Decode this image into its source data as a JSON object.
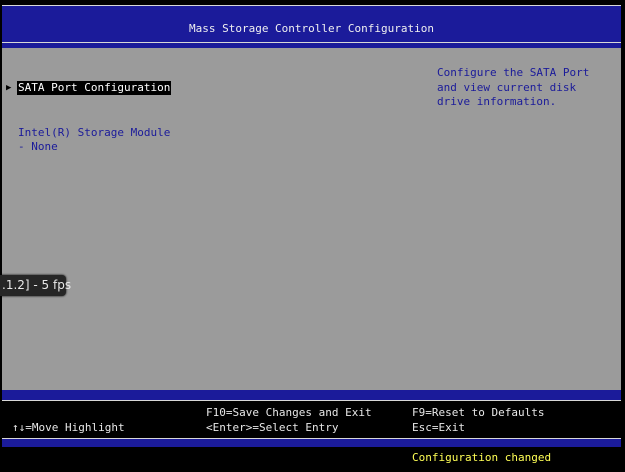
{
  "header": {
    "title": "Mass Storage Controller Configuration"
  },
  "main": {
    "selected_item": "SATA Port Configuration",
    "storage_module_label": "Intel(R) Storage Module",
    "storage_module_value": "- None",
    "help_text": "Configure the SATA Port and view current disk drive information."
  },
  "overlay": {
    "fps_text": ".1.2] - 5 fps"
  },
  "help_bar": {
    "move_highlight": "↑↓=Move Highlight",
    "save_exit": "F10=Save Changes and Exit",
    "select_entry": "<Enter>=Select Entry",
    "reset_defaults": "F9=Reset to Defaults",
    "esc_exit": "Esc=Exit"
  },
  "status": {
    "message": "Configuration changed"
  },
  "colors": {
    "bios_blue": "#1b1b9a",
    "panel_gray": "#9b9b9b",
    "status_yellow": "#ffff55"
  }
}
